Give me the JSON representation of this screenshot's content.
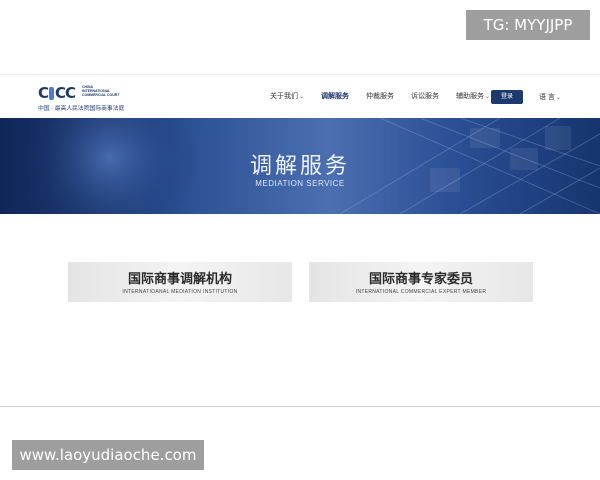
{
  "watermark": {
    "tg_label": "TG: MYYJJPP",
    "url_label": "www.laoyudiaoche.com"
  },
  "header": {
    "logo": {
      "letters": [
        "C",
        "C",
        "C"
      ],
      "en_line1": "CHINA",
      "en_line2": "INTERNATIONAL",
      "en_line3": "COMMERCIAL COURT",
      "cn": "中国 · 最高人民法院国际商事法庭"
    },
    "nav": [
      {
        "label": "关于我们",
        "has_dropdown": true
      },
      {
        "label": "调解服务",
        "active": true
      },
      {
        "label": "仲裁服务"
      },
      {
        "label": "诉讼服务"
      },
      {
        "label": "辅助服务",
        "has_dropdown": true
      }
    ],
    "login_label": "登录",
    "lang_label": "语 言"
  },
  "banner": {
    "title": "调解服务",
    "subtitle": "MEDIATION SERVICE"
  },
  "cards": [
    {
      "cn": "国际商事调解机构",
      "en": "INTERNATIOANAL MEDIATION INSTITUTION"
    },
    {
      "cn": "国际商事专家委员",
      "en": "INTERNATIONAL COMMERCIAL EXPERT MEMBER"
    }
  ],
  "colors": {
    "brand": "#1d3a6e",
    "accent": "#4c7bd4",
    "banner_dark": "#0f2657",
    "card_bg": "#ececec"
  }
}
